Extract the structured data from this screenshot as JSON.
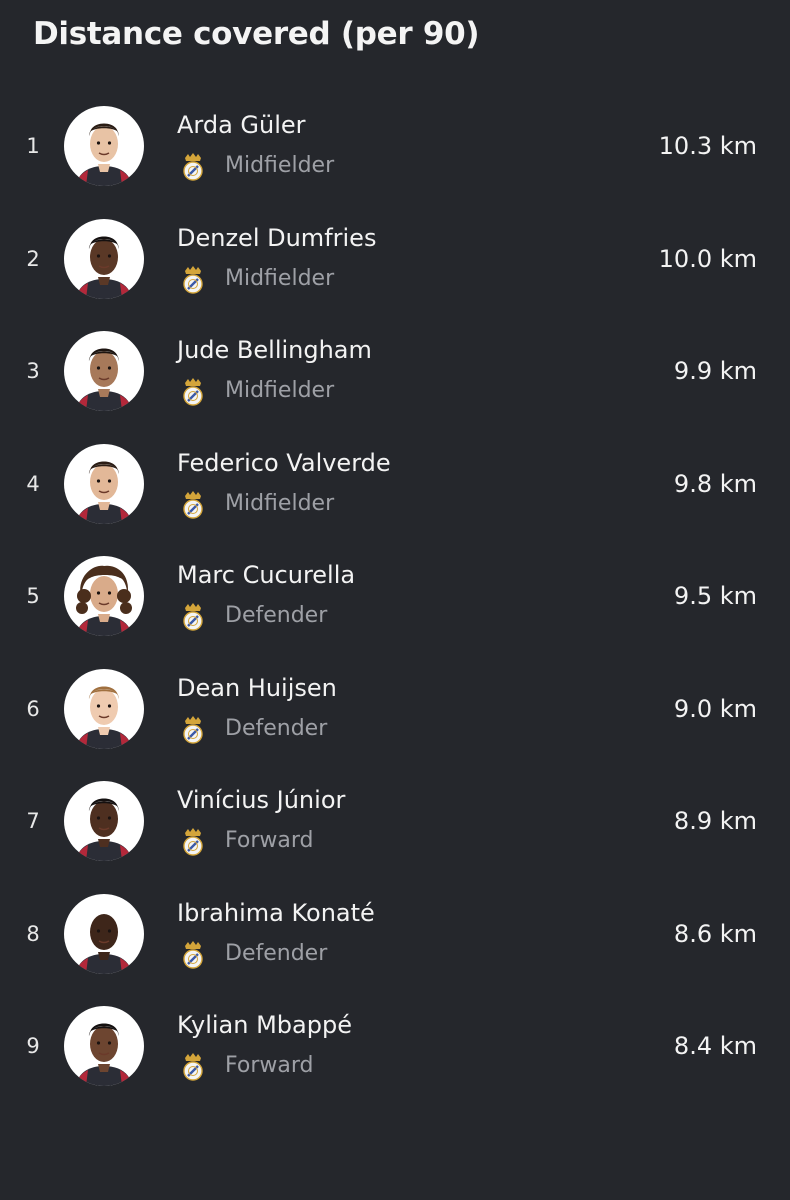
{
  "title": "Distance covered (per 90)",
  "colors": {
    "background": "#25272c",
    "text_primary": "#f3f3f3",
    "text_secondary": "#9ea0a6",
    "avatar_bg": "#ffffff"
  },
  "players": [
    {
      "rank": "1",
      "name": "Arda Güler",
      "position": "Midfielder",
      "distance": "10.3 km",
      "club_icon": "real-madrid-crest-icon",
      "skin": "#e8c3a5",
      "hair": "#2a1c14",
      "hair_style": "short"
    },
    {
      "rank": "2",
      "name": "Denzel Dumfries",
      "position": "Midfielder",
      "distance": "10.0 km",
      "club_icon": "real-madrid-crest-icon",
      "skin": "#5a3826",
      "hair": "#141010",
      "hair_style": "short"
    },
    {
      "rank": "3",
      "name": "Jude Bellingham",
      "position": "Midfielder",
      "distance": "9.9 km",
      "club_icon": "real-madrid-crest-icon",
      "skin": "#a7795a",
      "hair": "#1c1410",
      "hair_style": "short"
    },
    {
      "rank": "4",
      "name": "Federico Valverde",
      "position": "Midfielder",
      "distance": "9.8 km",
      "club_icon": "real-madrid-crest-icon",
      "skin": "#e2b898",
      "hair": "#2b1d15",
      "hair_style": "short"
    },
    {
      "rank": "5",
      "name": "Marc Cucurella",
      "position": "Defender",
      "distance": "9.5 km",
      "club_icon": "real-madrid-crest-icon",
      "skin": "#d9ab8a",
      "hair": "#4a2e1c",
      "hair_style": "curly"
    },
    {
      "rank": "6",
      "name": "Dean Huijsen",
      "position": "Defender",
      "distance": "9.0 km",
      "club_icon": "real-madrid-crest-icon",
      "skin": "#efcbb0",
      "hair": "#a0703f",
      "hair_style": "short"
    },
    {
      "rank": "7",
      "name": "Vinícius Júnior",
      "position": "Forward",
      "distance": "8.9 km",
      "club_icon": "real-madrid-crest-icon",
      "skin": "#4e2f20",
      "hair": "#141010",
      "hair_style": "short"
    },
    {
      "rank": "8",
      "name": "Ibrahima Konaté",
      "position": "Defender",
      "distance": "8.6 km",
      "club_icon": "real-madrid-crest-icon",
      "skin": "#3e261a",
      "hair": "#1a1210",
      "hair_style": "bald"
    },
    {
      "rank": "9",
      "name": "Kylian Mbappé",
      "position": "Forward",
      "distance": "8.4 km",
      "club_icon": "real-madrid-crest-icon",
      "skin": "#6d4530",
      "hair": "#141010",
      "hair_style": "short"
    }
  ]
}
